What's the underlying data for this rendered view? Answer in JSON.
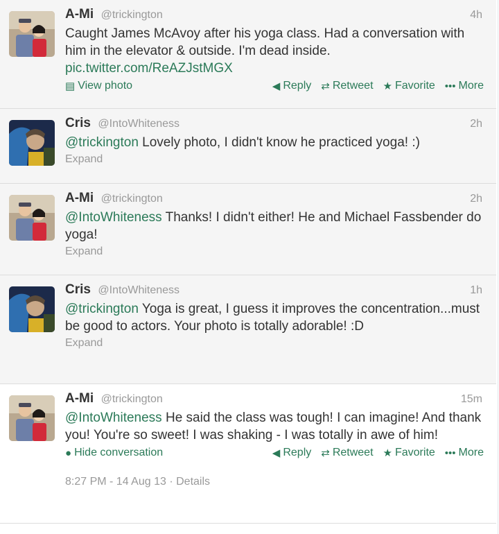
{
  "colors": {
    "accent": "#2b7a58",
    "muted": "#999999",
    "text": "#333333",
    "bg_collapsed": "#f5f5f5"
  },
  "actions": {
    "reply": "Reply",
    "retweet": "Retweet",
    "favorite": "Favorite",
    "more": "More",
    "view_photo": "View photo",
    "hide_conversation": "Hide conversation",
    "expand": "Expand"
  },
  "icons": {
    "reply": "reply-arrow-icon",
    "retweet": "retweet-icon",
    "favorite": "star-icon",
    "more": "more-dots-icon",
    "photo": "photo-icon",
    "conversation": "speech-bubble-icon"
  },
  "tweets": [
    {
      "name": "A-Mi",
      "handle": "@trickington",
      "time": "4h",
      "mention": "",
      "text": "Caught James McAvoy after his yoga class. Had a conversation with him in the elevator & outside. I'm dead inside.",
      "link": "pic.twitter.com/ReAZJstMGX"
    },
    {
      "name": "Cris",
      "handle": "@IntoWhiteness",
      "time": "2h",
      "mention": "@trickington",
      "text": " Lovely photo, I didn't know he practiced yoga! :)"
    },
    {
      "name": "A-Mi",
      "handle": "@trickington",
      "time": "2h",
      "mention": "@IntoWhiteness",
      "text": " Thanks! I didn't either! He and Michael Fassbender do yoga!"
    },
    {
      "name": "Cris",
      "handle": "@IntoWhiteness",
      "time": "1h",
      "mention": "@trickington",
      "text": " Yoga is great, I guess it improves the concentration...must be good to actors. Your photo is totally adorable! :D"
    },
    {
      "name": "A-Mi",
      "handle": "@trickington",
      "time": "15m",
      "mention": "@IntoWhiteness",
      "text": " He said the class was tough! I can imagine! And thank you! You're so sweet! I was shaking - I was totally in awe of him!",
      "timestamp": "8:27 PM - 14 Aug 13",
      "details": "Details"
    }
  ]
}
